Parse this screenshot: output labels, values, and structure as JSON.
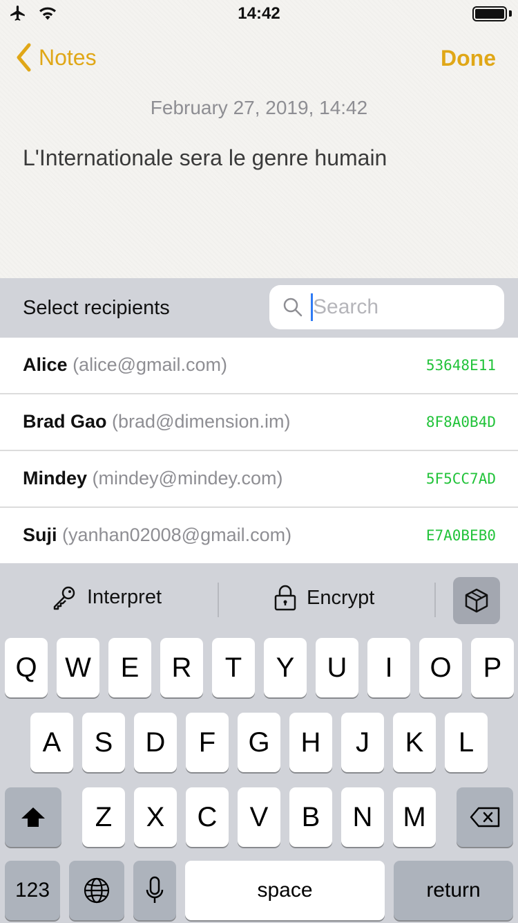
{
  "status_bar": {
    "time": "14:42"
  },
  "nav": {
    "back_label": "Notes",
    "done_label": "Done"
  },
  "note": {
    "date": "February 27, 2019, 14:42",
    "body": "L'Internationale sera le genre humain"
  },
  "recipients": {
    "title": "Select recipients",
    "search_placeholder": "Search",
    "items": [
      {
        "name": "Alice",
        "email": "(alice@gmail.com)",
        "key": "53648E11"
      },
      {
        "name": "Brad Gao",
        "email": "(brad@dimension.im)",
        "key": "8F8A0B4D"
      },
      {
        "name": "Mindey",
        "email": "(mindey@mindey.com)",
        "key": "5F5CC7AD"
      },
      {
        "name": "Suji",
        "email": "(yanhan02008@gmail.com)",
        "key": "E7A0BEB0"
      }
    ]
  },
  "toolbar": {
    "interpret_label": "Interpret",
    "encrypt_label": "Encrypt"
  },
  "keyboard": {
    "row1": [
      "Q",
      "W",
      "E",
      "R",
      "T",
      "Y",
      "U",
      "I",
      "O",
      "P"
    ],
    "row2": [
      "A",
      "S",
      "D",
      "F",
      "G",
      "H",
      "J",
      "K",
      "L"
    ],
    "row3": [
      "Z",
      "X",
      "C",
      "V",
      "B",
      "N",
      "M"
    ],
    "numbers_label": "123",
    "space_label": "space",
    "return_label": "return"
  },
  "colors": {
    "accent": "#e0a717",
    "key_id": "#22c33a",
    "caret": "#2f7bf5"
  }
}
